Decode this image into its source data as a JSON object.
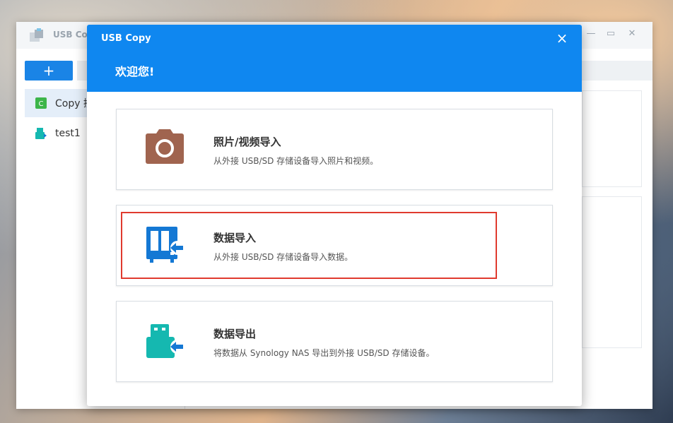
{
  "background_app": {
    "title": "USB Co",
    "add_label": "+",
    "sidebar": [
      {
        "label": "Copy 接",
        "icon": "copy-task-icon",
        "active": true
      },
      {
        "label": "test1",
        "icon": "usb-task-icon",
        "active": false
      }
    ]
  },
  "modal": {
    "title": "USB Copy",
    "close_label": "×",
    "welcome": "欢迎您!",
    "options": [
      {
        "title": "照片/视频导入",
        "desc": "从外接 USB/SD 存储设备导入照片和视频。",
        "icon": "camera-icon",
        "color": "#a0644f"
      },
      {
        "title": "数据导入",
        "desc": "从外接 USB/SD 存储设备导入数据。",
        "icon": "nas-import-icon",
        "color": "#1478d4"
      },
      {
        "title": "数据导出",
        "desc": "将数据从 Synology NAS 导出到外接 USB/SD 存储设备。",
        "icon": "usb-export-icon",
        "color": "#15b8b0"
      }
    ]
  },
  "colors": {
    "header_blue": "#0f87f0",
    "highlight_red": "#e03a2e"
  }
}
